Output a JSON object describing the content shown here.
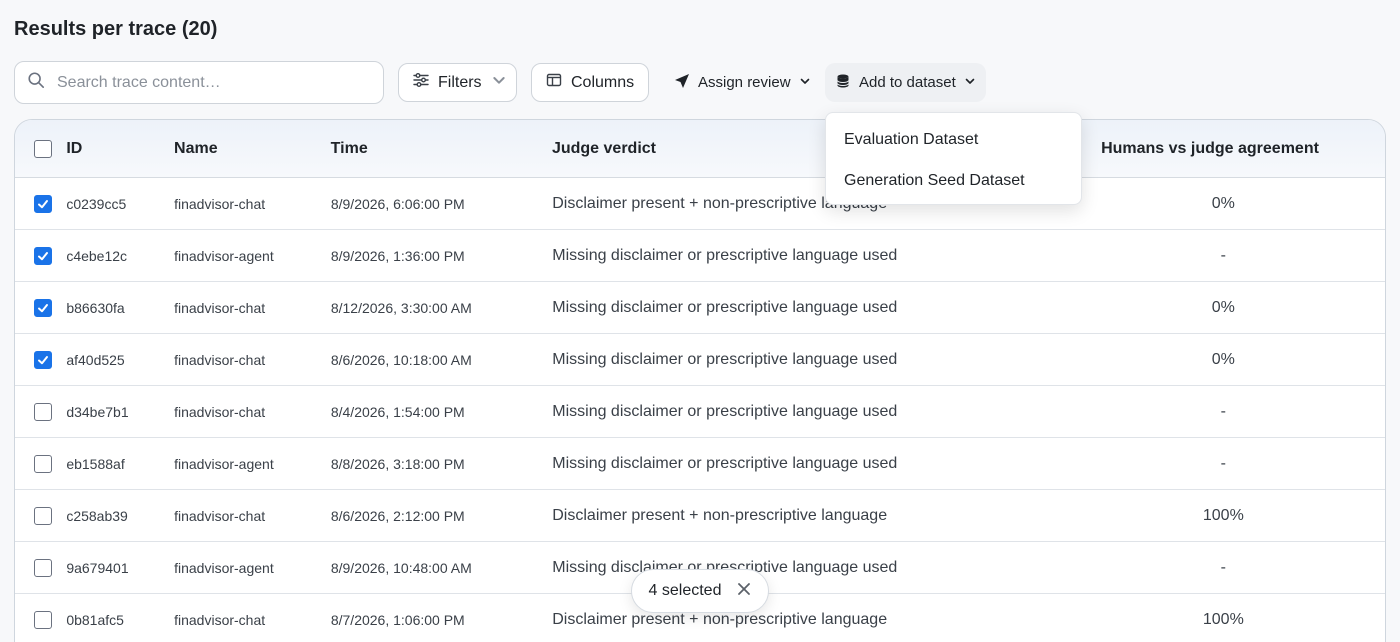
{
  "page": {
    "title": "Results per trace (20)"
  },
  "toolbar": {
    "search_placeholder": "Search trace content…",
    "filters_label": "Filters",
    "columns_label": "Columns",
    "assign_review_label": "Assign review",
    "add_to_dataset_label": "Add to dataset"
  },
  "dataset_menu": {
    "items": [
      "Evaluation Dataset",
      "Generation Seed Dataset"
    ]
  },
  "table": {
    "headers": {
      "id": "ID",
      "name": "Name",
      "time": "Time",
      "verdict": "Judge verdict",
      "agreement": "Humans vs judge agreement"
    },
    "rows": [
      {
        "checked": true,
        "id": "c0239cc5",
        "name": "finadvisor-chat",
        "time": "8/9/2026, 6:06:00 PM",
        "verdict": "Disclaimer present + non-prescriptive language",
        "agreement": "0%"
      },
      {
        "checked": true,
        "id": "c4ebe12c",
        "name": "finadvisor-agent",
        "time": "8/9/2026, 1:36:00 PM",
        "verdict": "Missing disclaimer or prescriptive language used",
        "agreement": "-"
      },
      {
        "checked": true,
        "id": "b86630fa",
        "name": "finadvisor-chat",
        "time": "8/12/2026, 3:30:00 AM",
        "verdict": "Missing disclaimer or prescriptive language used",
        "agreement": "0%"
      },
      {
        "checked": true,
        "id": "af40d525",
        "name": "finadvisor-chat",
        "time": "8/6/2026, 10:18:00 AM",
        "verdict": "Missing disclaimer or prescriptive language used",
        "agreement": "0%"
      },
      {
        "checked": false,
        "id": "d34be7b1",
        "name": "finadvisor-chat",
        "time": "8/4/2026, 1:54:00 PM",
        "verdict": "Missing disclaimer or prescriptive language used",
        "agreement": "-"
      },
      {
        "checked": false,
        "id": "eb1588af",
        "name": "finadvisor-agent",
        "time": "8/8/2026, 3:18:00 PM",
        "verdict": "Missing disclaimer or prescriptive language used",
        "agreement": "-"
      },
      {
        "checked": false,
        "id": "c258ab39",
        "name": "finadvisor-chat",
        "time": "8/6/2026, 2:12:00 PM",
        "verdict": "Disclaimer present + non-prescriptive language",
        "agreement": "100%"
      },
      {
        "checked": false,
        "id": "9a679401",
        "name": "finadvisor-agent",
        "time": "8/9/2026, 10:48:00 AM",
        "verdict": "Missing disclaimer or prescriptive language used",
        "agreement": "-"
      },
      {
        "checked": false,
        "id": "0b81afc5",
        "name": "finadvisor-chat",
        "time": "8/7/2026, 1:06:00 PM",
        "verdict": "Disclaimer present + non-prescriptive language",
        "agreement": "100%"
      }
    ]
  },
  "selection": {
    "label": "4 selected"
  },
  "colors": {
    "accent": "#1a73e8",
    "border": "#cfd4da",
    "header_bg": "#edf2f9"
  }
}
